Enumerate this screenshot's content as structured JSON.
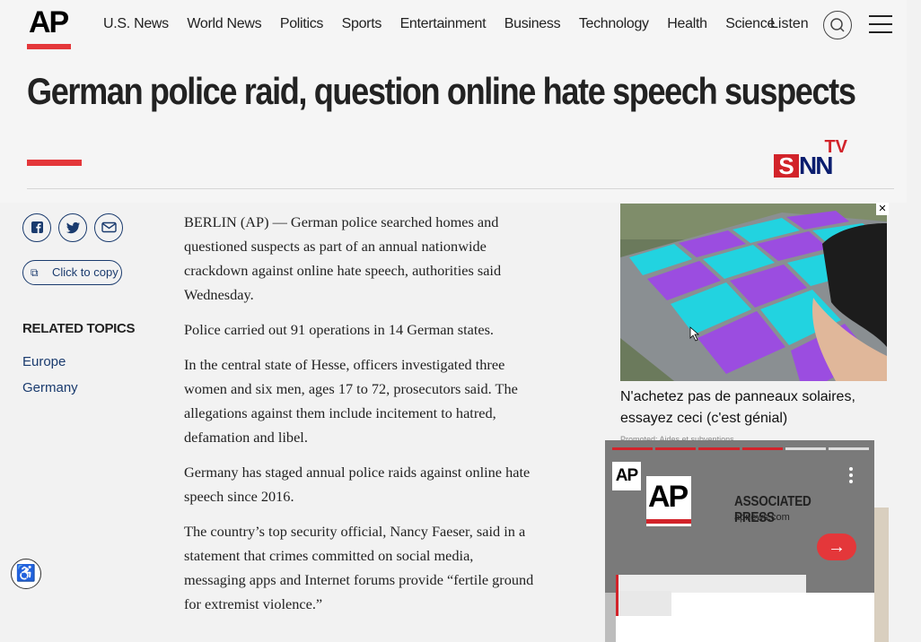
{
  "header": {
    "logo_text": "AP",
    "nav": [
      "U.S. News",
      "World News",
      "Politics",
      "Sports",
      "Entertainment",
      "Business",
      "Technology",
      "Health",
      "Science"
    ],
    "listen_label": "Listen",
    "colors": {
      "accent": "#e4373a",
      "link": "#1a3b6e"
    }
  },
  "article": {
    "headline": "German police raid, question online hate speech suspects",
    "paragraphs": [
      "BERLIN (AP) — German police searched homes and questioned suspects as part of an annual nationwide crackdown against online hate speech, authorities said Wednesday.",
      "Police carried out 91 operations in 14 German states.",
      "In the central state of Hesse, officers investigated three women and six men, ages 17 to 72, prosecutors said. The allegations against them include incitement to hatred, defamation and libel.",
      "Germany has staged annual police raids against online hate speech since 2016.",
      "The country’s top security official, Nancy Faeser, said in a statement that crimes committed on social media, messaging apps and Internet forums provide “fertile ground for extremist violence.”"
    ]
  },
  "snn_logo": {
    "tv": "TV",
    "s": "S",
    "nn": "NN"
  },
  "sidebar": {
    "share_icons": [
      "facebook-icon",
      "twitter-icon",
      "email-icon"
    ],
    "copy_label": "Click to copy",
    "related_title": "RELATED TOPICS",
    "related_items": [
      "Europe",
      "Germany"
    ]
  },
  "ad": {
    "title": "N'achetez pas de panneaux solaires, essayez ceci (c'est génial)",
    "promo": "Promoted: Aides et subventions"
  },
  "video_player": {
    "mini_logo": "AP",
    "big_logo": "AP",
    "brand_name": "ASSOCIATED PRESS",
    "brand_url": "apnews.com",
    "arrow": "→"
  }
}
